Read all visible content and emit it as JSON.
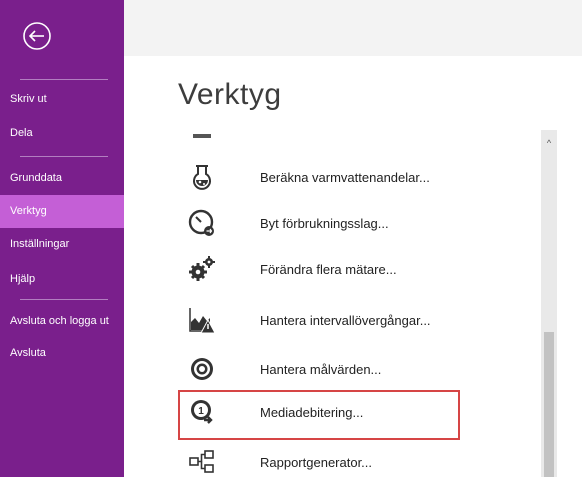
{
  "sidebar": {
    "items": [
      {
        "label": "Skriv ut"
      },
      {
        "label": "Dela"
      },
      {
        "label": "Grunddata"
      },
      {
        "label": "Verktyg",
        "active": true
      },
      {
        "label": "Inställningar"
      },
      {
        "label": "Hjälp"
      },
      {
        "label": "Avsluta och logga ut"
      },
      {
        "label": "Avsluta"
      }
    ],
    "colors": {
      "background": "#7a1f8c",
      "active": "#c45fd6"
    }
  },
  "main": {
    "title": "Verktyg",
    "tools": [
      {
        "label": "Beräkna varmvattenandelar...",
        "icon": "beaker-icon"
      },
      {
        "label": "Byt förbrukningsslag...",
        "icon": "gauge-swap-icon"
      },
      {
        "label": "Förändra flera mätare...",
        "icon": "gears-icon"
      },
      {
        "label": "Hantera intervallövergångar...",
        "icon": "chart-warning-icon"
      },
      {
        "label": "Hantera målvärden...",
        "icon": "target-icon"
      },
      {
        "label": "Mediadebitering...",
        "icon": "media-billing-icon",
        "selected": true
      },
      {
        "label": "Rapportgenerator...",
        "icon": "flowchart-icon"
      }
    ],
    "highlight_color": "#d64545"
  },
  "scrollbar": {
    "up_arrow": "^"
  }
}
